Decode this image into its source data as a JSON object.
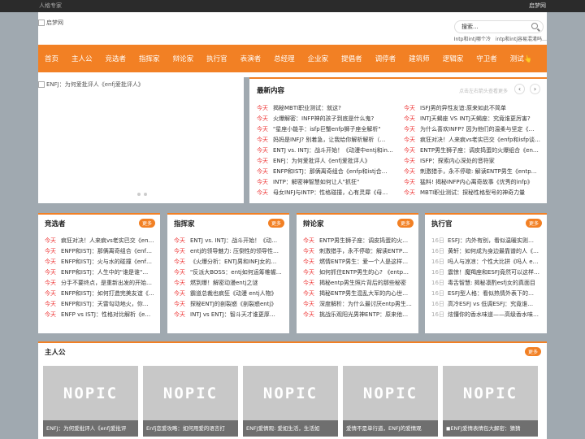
{
  "topbar": {
    "left": "人格专家",
    "right": "启梦网"
  },
  "header": {
    "logo_alt": "启梦网",
    "search_value": "搜索...",
    "hot": [
      "Intp和intj哪个冷",
      "intp和intj容易混淆吗…"
    ]
  },
  "nav": [
    "首页",
    "主人公",
    "竞选者",
    "指挥家",
    "辩论家",
    "执行官",
    "表演者",
    "总经理",
    "企业家",
    "提倡者",
    "调停者",
    "建筑师",
    "逻辑家",
    "守卫者",
    "测试👆"
  ],
  "slider": {
    "caption": "ENFJ：为何爱批评人《enfj爱批评人》"
  },
  "latest": {
    "title": "最新内容",
    "tip": "点击左右箭头查看更多",
    "prev": "‹",
    "next": "›",
    "left": [
      {
        "d": "今天",
        "t": "揭秘MBTI职业测试：就这?"
      },
      {
        "d": "今天",
        "t": "火爆解密：INFP神的孩子到底是什么鬼?"
      },
      {
        "d": "今天",
        "t": "\"星座小能手：isfp巨蟹enfp狮子座全解析\""
      },
      {
        "d": "今天",
        "t": "妈妈是INFJ? 别着急，让我给你解析解析（…"
      },
      {
        "d": "今天",
        "t": "ENTJ vs. INTJ：战斗开始！《动漫中entj和in…"
      },
      {
        "d": "今天",
        "t": "ENFJ：为何爱批评人《enfj爱批评人》"
      },
      {
        "d": "今天",
        "t": "ENFP和ISTJ：那俩离奇组合《enfp和istj合…"
      },
      {
        "d": "今天",
        "t": "INTP：解密神智慧如何让人\"抓狂\""
      },
      {
        "d": "今天",
        "t": "母女INFJ与INTP：性格碰撞，心有灵犀《母…"
      }
    ],
    "right": [
      {
        "d": "今天",
        "t": "ISFJ男的异性友谊:原来如此不简单"
      },
      {
        "d": "今天",
        "t": "INTJ天蝎座 VS INTJ天蝎座：究竟谁更厉害?"
      },
      {
        "d": "今天",
        "t": "为什么喜欢INFP? 因为他们的温柔与坚定《…"
      },
      {
        "d": "今天",
        "t": "疯狂对决！人来疯vs老实巴交《enfp和isfp谈…"
      },
      {
        "d": "今天",
        "t": "ENTP男生狮子座：调皮捣蛋的火爆组合《en…"
      },
      {
        "d": "今天",
        "t": "ISFP：探索内心深处的音符家"
      },
      {
        "d": "今天",
        "t": "刺激猎手，永不停歇: 解读ENTP男生《entp…"
      },
      {
        "d": "今天",
        "t": "猛料! 揭秘INFP内心离奇故事《优秀的infp》"
      },
      {
        "d": "今天",
        "t": "MBTI职业测试：探秘性格型号的神奇力量"
      }
    ]
  },
  "boxes": [
    {
      "title": "竞选者",
      "more": "更多",
      "items": [
        {
          "d": "今天",
          "t": "疯狂对决！人来疯vs老实巴交《enfp…"
        },
        {
          "d": "今天",
          "t": "ENFP和ISTJ：那俩离奇组合《enfp和…"
        },
        {
          "d": "今天",
          "t": "ENFP和ISTJ：火与水的碰撞《enfp…"
        },
        {
          "d": "今天",
          "t": "ENFP和ISTJ：人生中的\"谁是谁\"…"
        },
        {
          "d": "今天",
          "t": "分手不要终点，是重新出发的开始…"
        },
        {
          "d": "今天",
          "t": "ENFP和ISTJ：如何打造完美友谊《…"
        },
        {
          "d": "今天",
          "t": "ENFP和ISTJ：天雷勾动地火，你…"
        },
        {
          "d": "今天",
          "t": "ENFP vs ISTJ：性格对比解析《e…"
        }
      ]
    },
    {
      "title": "指挥家",
      "more": "更多",
      "items": [
        {
          "d": "今天",
          "t": "ENTJ vs. INTJ：战斗开始！《动…"
        },
        {
          "d": "今天",
          "t": "entj的领导魅力: 压倒性的领导性…"
        },
        {
          "d": "今天",
          "t": "《火爆分析：ENTJ男和INFJ女的…"
        },
        {
          "d": "今天",
          "t": "\"反派大BOSS：entj如何运筹帷幄…"
        },
        {
          "d": "今天",
          "t": "燃到爆！解密动漫entj之谜"
        },
        {
          "d": "今天",
          "t": "霸道总裁也疯狂《动漫 entj人物》"
        },
        {
          "d": "今天",
          "t": "探秘ENTJ的剖裂惑《剖裂惑entj》"
        },
        {
          "d": "今天",
          "t": "INTJ vs ENTJ：智斗天才谁更厚…"
        }
      ]
    },
    {
      "title": "辩论家",
      "more": "更多",
      "items": [
        {
          "d": "今天",
          "t": "ENTP男生狮子座：调皮捣蛋的火…"
        },
        {
          "d": "今天",
          "t": "刺激猎手，永不停歇：解读ENTP…"
        },
        {
          "d": "今天",
          "t": "燃情ENTP男生：爱一个人是这样…"
        },
        {
          "d": "今天",
          "t": "如何抓住ENTP男生的心? 《entp…"
        },
        {
          "d": "今天",
          "t": "揭秘entp男生照片背后的那些秘密"
        },
        {
          "d": "今天",
          "t": "揭秘ENTP男生混乱大军的内心世…"
        },
        {
          "d": "今天",
          "t": "深度解析：为什么最讨厌entp男生…"
        },
        {
          "d": "今天",
          "t": "挑战乐观阳光男神ENTP：原来他…"
        }
      ]
    },
    {
      "title": "执行官",
      "more": "更多",
      "items": [
        {
          "d": "16日",
          "t": "ESFJ：内外有别，看似温暖实则…"
        },
        {
          "d": "16日",
          "t": "黄轩：如何成为身边最靠谱的人《…"
        },
        {
          "d": "16日",
          "t": "吗人与凉凉：个性大比拼《吗人 e…"
        },
        {
          "d": "16日",
          "t": "震惊！魔羯座和ESFJ竟然可以这样…"
        },
        {
          "d": "16日",
          "t": "毒舌智慧: 揭秘凛酌esfj女的真面目"
        },
        {
          "d": "16日",
          "t": "ESFJ型人格：看似热情外表下的…"
        },
        {
          "d": "16日",
          "t": "高冷ESFJ vs 低调ESFJ：究竟谁…"
        },
        {
          "d": "16日",
          "t": "炫懂你的香水味道——高级香水味…"
        }
      ]
    }
  ],
  "main": {
    "title": "主人公",
    "more": "更多",
    "nopic": "NOPIC",
    "items": [
      "ENFJ：为何爱批评人《enfj爱批评",
      "Enfj恋爱攻略：如何用爱的语言打",
      "ENFJ爱情观: 爱如生活，生活如",
      "爱情不是单行道，ENFJ的爱情观",
      "◼ENFJ爱情表情包大解密：猜猜"
    ]
  }
}
